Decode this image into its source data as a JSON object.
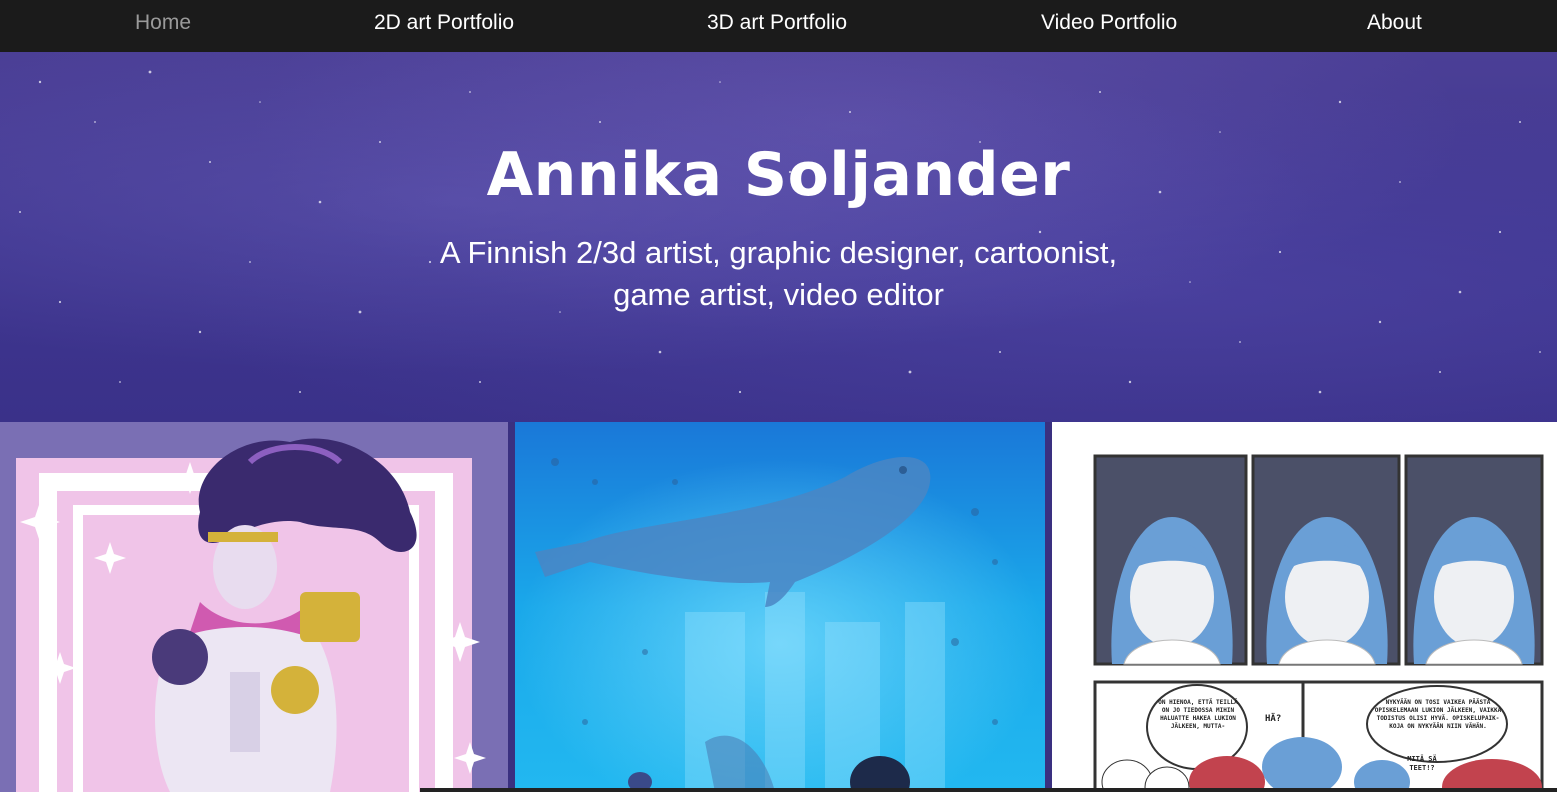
{
  "nav": {
    "items": [
      {
        "label": "Home",
        "active": true
      },
      {
        "label": "2D art Portfolio",
        "active": false
      },
      {
        "label": "3D art Portfolio",
        "active": false
      },
      {
        "label": "Video Portfolio",
        "active": false
      },
      {
        "label": "About",
        "active": false
      }
    ]
  },
  "hero": {
    "title": "Annika Soljander",
    "subtitle_line1": "A Finnish 2/3d artist, graphic designer, cartoonist,",
    "subtitle_line2": "game artist, video editor"
  },
  "gallery": {
    "comic_bubbles": [
      "ON HIENOA, ETTÄ TEILLÄ ON JO TIEDOSSA MIHIN HALUATTE HAKEA LUKION JÄLKEEN, MUTTA-",
      "HÄ?",
      "NYKYÄÄN ON TOSI VAIKEA PÄÄSTÄ OPISKELEMAAN LUKION JÄLKEEN, VAIKKA TODISTUS OLISI HYVÄ. OPISKELUPAIK-KOJA ON NYKYÄÄN NIIN VÄHÄN.",
      "MITÄ SÄ TEET!?"
    ]
  },
  "colors": {
    "nav_bg": "#1b1b1b",
    "hero_bg": "#3f3690",
    "active_nav": "#9a9a9a"
  }
}
